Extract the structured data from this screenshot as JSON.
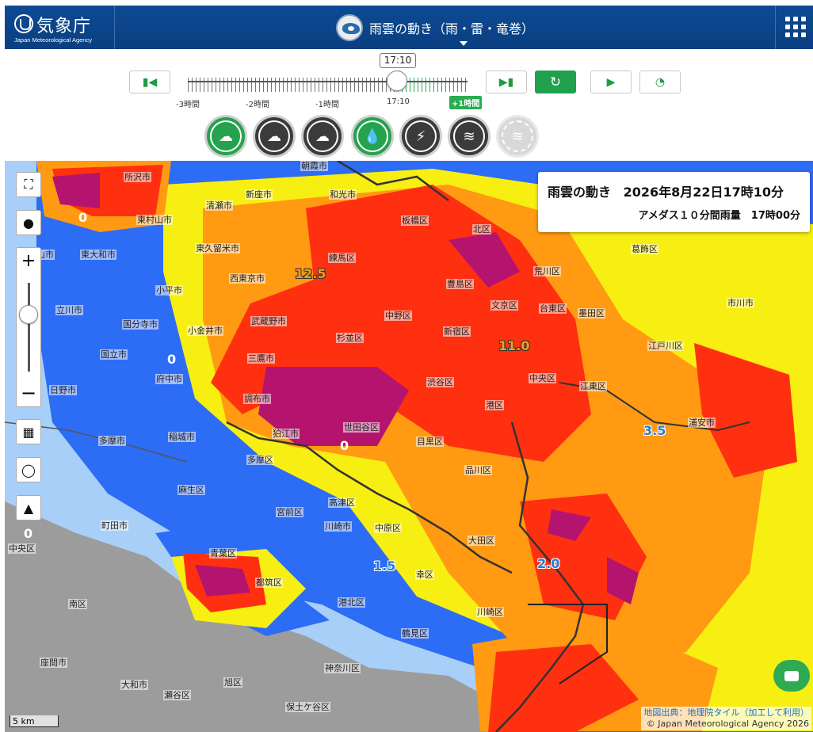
{
  "header": {
    "logo_name": "気象庁",
    "logo_sub": "Japan Meteorological Agency",
    "title": "雨雲の動き（雨・雷・竜巻）"
  },
  "playback": {
    "current_time": "17:10",
    "tick_labels": [
      "-3時間",
      "-2時間",
      "-1時間",
      "17:10",
      "+1時間"
    ],
    "position_fraction": 0.75,
    "buttons": [
      "skip-back",
      "skip-forward",
      "reload",
      "play",
      "speed"
    ]
  },
  "layers": [
    {
      "name": "rain-cloud-radar-icon",
      "selected": true
    },
    {
      "name": "thunder-cloud-icon",
      "selected": false
    },
    {
      "name": "tornado-cloud-icon",
      "selected": false
    },
    {
      "name": "rain-drop-icon",
      "selected": true
    },
    {
      "name": "lightning-icon",
      "selected": false
    },
    {
      "name": "tornado-icon",
      "selected": false
    },
    {
      "name": "tornado-disabled-icon",
      "selected": false,
      "disabled": true
    }
  ],
  "info": {
    "title": "雨雲の動き",
    "datetime": "2026年8月22日17時10分",
    "subtitle": "アメダス１０分間雨量　17時00分"
  },
  "amedas": [
    {
      "value": "0",
      "color": "#ffffff"
    },
    {
      "value": "12.5",
      "color": "#f0a020"
    },
    {
      "value": "11.0",
      "color": "#f0a020"
    },
    {
      "value": "0",
      "color": "#ffffff"
    },
    {
      "value": "0",
      "color": "#ffffff"
    },
    {
      "value": "3.5",
      "color": "#2a7ad0"
    },
    {
      "value": "1.5",
      "color": "#2a7ad0"
    },
    {
      "value": "2.0",
      "color": "#2a7ad0"
    },
    {
      "value": "0",
      "color": "#ffffff"
    }
  ],
  "places": [
    "所沢市",
    "新座市",
    "和光市",
    "朝霞市",
    "清瀬市",
    "東村山市",
    "東久留米市",
    "板橋区",
    "北区",
    "村山市",
    "東大和市",
    "練馬区",
    "葛飾区",
    "西東京市",
    "荒川区",
    "小平市",
    "豊島区",
    "文京区",
    "台東区",
    "墨田区",
    "市川市",
    "立川市",
    "国分寺市",
    "小金井市",
    "武蔵野市",
    "中野区",
    "新宿区",
    "杉並区",
    "江戸川区",
    "国立市",
    "府中市",
    "三鷹市",
    "中央区",
    "日野市",
    "調布市",
    "渋谷区",
    "江東区",
    "港区",
    "浦安市",
    "多摩市",
    "稲城市",
    "狛江市",
    "世田谷区",
    "目黒区",
    "多摩区",
    "麻生区",
    "品川区",
    "宮前区",
    "高津区",
    "町田市",
    "川崎市",
    "中原区",
    "大田区",
    "中央区",
    "青葉区",
    "都筑区",
    "港北区",
    "幸区",
    "南区",
    "川崎区",
    "鶴見区",
    "座間市",
    "神奈川区",
    "大和市",
    "瀬谷区",
    "旭区",
    "保土ケ谷区"
  ],
  "scale_label": "5 km",
  "attribution": {
    "line1": "地図出典：地理院タイル（加工して利用）",
    "line2": "© Japan Meteorological Agency 2026"
  },
  "legend_colors": {
    "light_blue": "#a0d2ff",
    "blue": "#2156ff",
    "yellow": "#faf500",
    "orange": "#ff9900",
    "red": "#ff2800",
    "purple": "#b4006a"
  }
}
